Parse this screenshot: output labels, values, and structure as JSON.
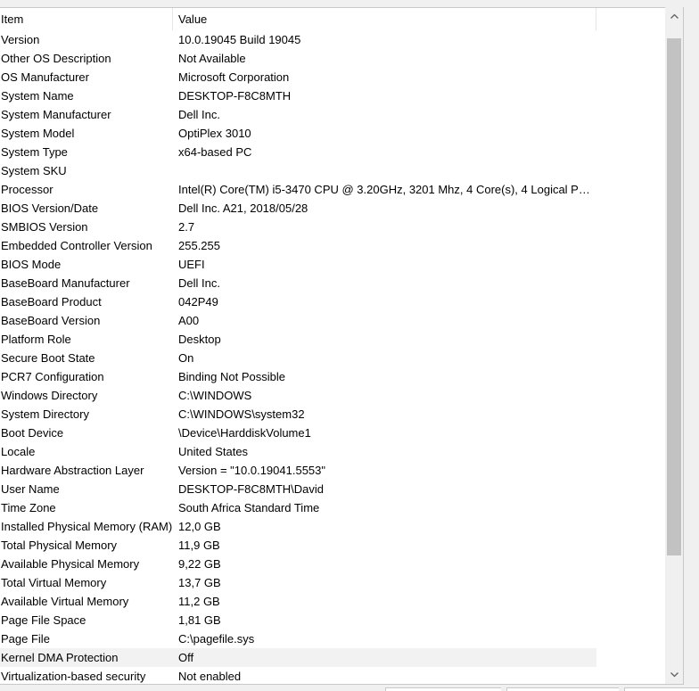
{
  "columns": {
    "item": "Item",
    "value": "Value"
  },
  "rows": [
    {
      "item": "Version",
      "value": "10.0.19045 Build 19045"
    },
    {
      "item": "Other OS Description",
      "value": "Not Available"
    },
    {
      "item": "OS Manufacturer",
      "value": "Microsoft Corporation"
    },
    {
      "item": "System Name",
      "value": "DESKTOP-F8C8MTH"
    },
    {
      "item": "System Manufacturer",
      "value": "Dell Inc."
    },
    {
      "item": "System Model",
      "value": "OptiPlex 3010"
    },
    {
      "item": "System Type",
      "value": "x64-based PC"
    },
    {
      "item": "System SKU",
      "value": ""
    },
    {
      "item": "Processor",
      "value": "Intel(R) Core(TM) i5-3470 CPU @ 3.20GHz, 3201 Mhz, 4 Core(s), 4 Logical Pro..."
    },
    {
      "item": "BIOS Version/Date",
      "value": "Dell Inc. A21, 2018/05/28"
    },
    {
      "item": "SMBIOS Version",
      "value": "2.7"
    },
    {
      "item": "Embedded Controller Version",
      "value": "255.255"
    },
    {
      "item": "BIOS Mode",
      "value": "UEFI"
    },
    {
      "item": "BaseBoard Manufacturer",
      "value": "Dell Inc."
    },
    {
      "item": "BaseBoard Product",
      "value": "042P49"
    },
    {
      "item": "BaseBoard Version",
      "value": "A00"
    },
    {
      "item": "Platform Role",
      "value": "Desktop"
    },
    {
      "item": "Secure Boot State",
      "value": "On"
    },
    {
      "item": "PCR7 Configuration",
      "value": "Binding Not Possible"
    },
    {
      "item": "Windows Directory",
      "value": "C:\\WINDOWS"
    },
    {
      "item": "System Directory",
      "value": "C:\\WINDOWS\\system32"
    },
    {
      "item": "Boot Device",
      "value": "\\Device\\HarddiskVolume1"
    },
    {
      "item": "Locale",
      "value": "United States"
    },
    {
      "item": "Hardware Abstraction Layer",
      "value": "Version = \"10.0.19041.5553\""
    },
    {
      "item": "User Name",
      "value": "DESKTOP-F8C8MTH\\David"
    },
    {
      "item": "Time Zone",
      "value": "South Africa Standard Time"
    },
    {
      "item": "Installed Physical Memory (RAM)",
      "value": "12,0 GB"
    },
    {
      "item": "Total Physical Memory",
      "value": "11,9 GB"
    },
    {
      "item": "Available Physical Memory",
      "value": "9,22 GB"
    },
    {
      "item": "Total Virtual Memory",
      "value": "13,7 GB"
    },
    {
      "item": "Available Virtual Memory",
      "value": "11,2 GB"
    },
    {
      "item": "Page File Space",
      "value": "1,81 GB"
    },
    {
      "item": "Page File",
      "value": "C:\\pagefile.sys"
    },
    {
      "item": "Kernel DMA Protection",
      "value": "Off",
      "selected": true
    },
    {
      "item": "Virtualization-based security",
      "value": "Not enabled"
    }
  ],
  "icons": {
    "scroll_up": "chevron-up-icon",
    "scroll_down": "chevron-down-icon"
  },
  "colors": {
    "selected_row": "#f2f2f2",
    "scroll_thumb": "#c2c2c2",
    "background": "#ffffff"
  }
}
